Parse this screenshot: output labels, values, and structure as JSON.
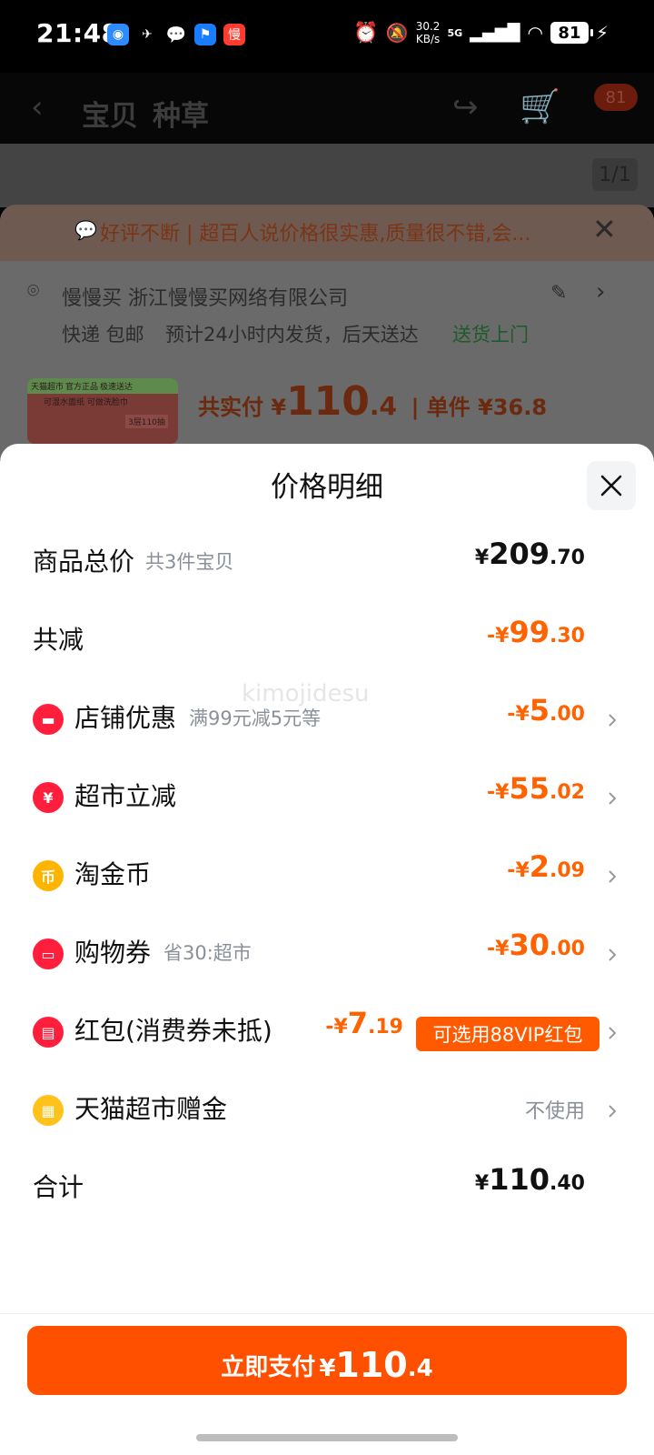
{
  "status_bar": {
    "time": "21:48",
    "speed_value": "30.2",
    "speed_unit": "KB/s",
    "network": "5G",
    "battery": "81"
  },
  "background": {
    "nav_tab_1": "宝贝",
    "nav_tab_2": "种草",
    "cart_badge": "81",
    "pager": "1/1",
    "promo_text": "好评不断 | 超百人说价格很实惠,质量很不错,会...",
    "address_line": "慢慢买 浙江慢慢买网络有限公司",
    "delivery_1": "快递 包邮",
    "delivery_2": "预计24小时内发货，后天送达",
    "delivery_3": "送货上门",
    "total_label": "共实付 ¥",
    "total_int": "110",
    "total_dec": ".4",
    "unit_price": "| 单件 ¥36.8",
    "product_tags": [
      "天猫超市",
      "官方正品",
      "极速送达"
    ],
    "product_caption": "可湿水面纸 可做洗脸巾",
    "product_badge": "3层110抽"
  },
  "modal": {
    "title": "价格明细",
    "rows": [
      {
        "label": "商品总价",
        "sub": "共3件宝贝",
        "sign": "",
        "currency": "¥",
        "int": "209",
        "dec": ".70"
      },
      {
        "label": "共减",
        "sub": "",
        "sign": "-",
        "currency": "¥",
        "int": "99",
        "dec": ".30"
      },
      {
        "label": "店铺优惠",
        "sub": "满99元减5元等",
        "sign": "-",
        "currency": "¥",
        "int": "5",
        "dec": ".00",
        "icon": "shop-coupon-icon"
      },
      {
        "label": "超市立减",
        "sub": "",
        "sign": "-",
        "currency": "¥",
        "int": "55",
        "dec": ".02",
        "icon": "yuan-icon"
      },
      {
        "label": "淘金币",
        "sub": "",
        "sign": "-",
        "currency": "¥",
        "int": "2",
        "dec": ".09",
        "icon": "coin-icon"
      },
      {
        "label": "购物券",
        "sub": "省30:超市",
        "sign": "-",
        "currency": "¥",
        "int": "30",
        "dec": ".00",
        "icon": "ticket-icon"
      },
      {
        "label": "红包(消费券未抵)",
        "sub": "",
        "sign": "-",
        "currency": "¥",
        "int": "7",
        "dec": ".19",
        "icon": "red-packet-icon",
        "badge": "可选用88VIP红包"
      },
      {
        "label": "天猫超市赠金",
        "sub": "",
        "value_text": "不使用",
        "icon": "gift-card-icon"
      },
      {
        "label": "合计",
        "sub": "",
        "sign": "",
        "currency": "¥",
        "int": "110",
        "dec": ".40"
      }
    ],
    "pay_button": {
      "label": "立即支付",
      "currency": "¥",
      "int": "110",
      "dec": ".4"
    }
  },
  "watermark": "kimojidesu",
  "colors": {
    "accent": "#ff5000",
    "discount": "#ff6200",
    "muted": "#8a9099"
  }
}
